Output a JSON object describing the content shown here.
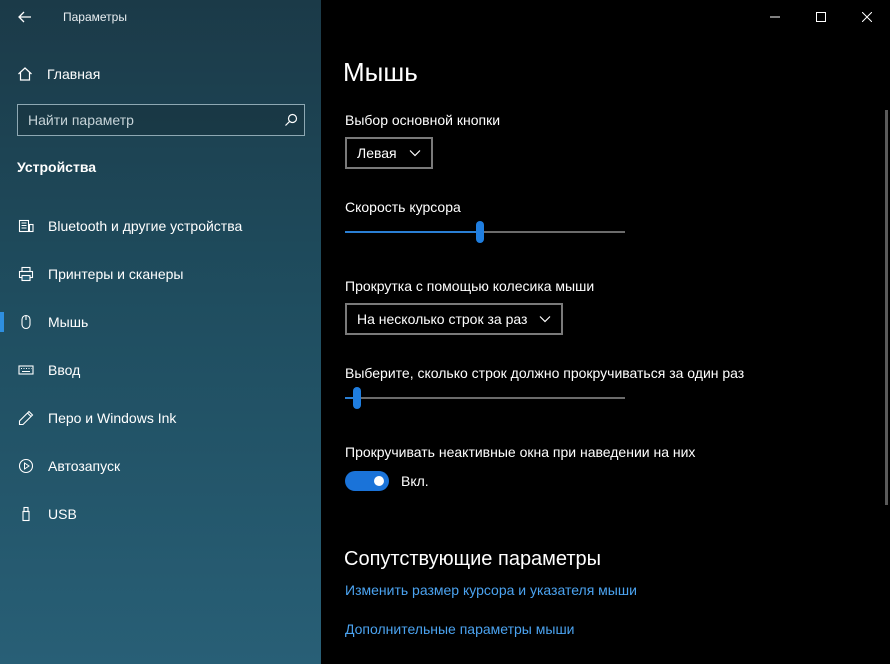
{
  "window": {
    "app_title": "Параметры",
    "controls": {
      "minimize": "minimize-icon",
      "maximize": "maximize-icon",
      "close": "close-icon"
    }
  },
  "sidebar": {
    "home_label": "Главная",
    "search_placeholder": "Найти параметр",
    "section_title": "Устройства",
    "items": [
      {
        "label": "Bluetooth и другие устройства",
        "icon": "bluetooth-devices-icon",
        "active": false
      },
      {
        "label": "Принтеры и сканеры",
        "icon": "printer-icon",
        "active": false
      },
      {
        "label": "Мышь",
        "icon": "mouse-icon",
        "active": true
      },
      {
        "label": "Ввод",
        "icon": "keyboard-icon",
        "active": false
      },
      {
        "label": "Перо и Windows Ink",
        "icon": "pen-icon",
        "active": false
      },
      {
        "label": "Автозапуск",
        "icon": "autoplay-icon",
        "active": false
      },
      {
        "label": "USB",
        "icon": "usb-icon",
        "active": false
      }
    ]
  },
  "main": {
    "title": "Мышь",
    "primary_button": {
      "label": "Выбор основной кнопки",
      "value": "Левая"
    },
    "cursor_speed": {
      "label": "Скорость курсора",
      "level_fraction": 0.48
    },
    "wheel_scroll": {
      "label": "Прокрутка с помощью колесика мыши",
      "value": "На несколько строк за раз"
    },
    "lines_to_scroll": {
      "label": "Выберите, сколько строк должно прокручиваться за один раз",
      "level_fraction": 0.03
    },
    "inactive_scroll": {
      "label": "Прокручивать неактивные окна при наведении на них",
      "state_label": "Вкл.",
      "on": true
    },
    "related": {
      "title": "Сопутствующие параметры",
      "links": [
        "Изменить размер курсора и указателя мыши",
        "Дополнительные параметры мыши"
      ]
    }
  },
  "colors": {
    "accent": "#1f7ee0",
    "link": "#4ba3f0",
    "sidebar_bg": "#1f4d5f",
    "main_bg": "#000000"
  }
}
